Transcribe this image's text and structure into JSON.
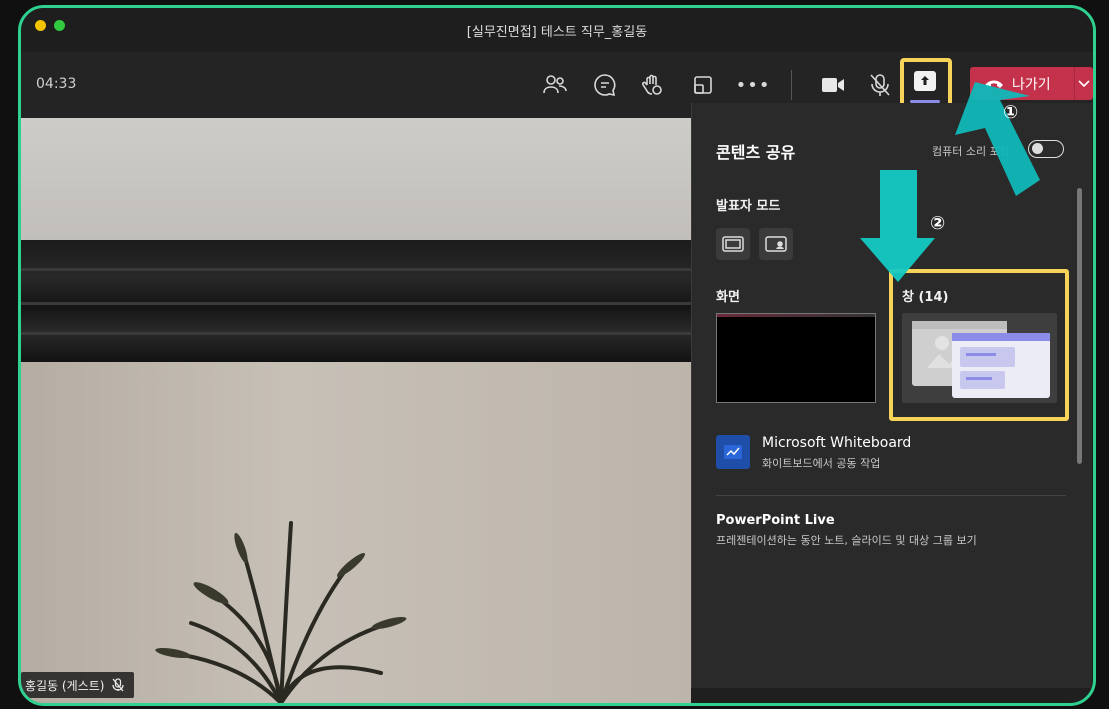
{
  "window": {
    "title": "[실무진면접] 테스트 직무_홍길동"
  },
  "toolbar": {
    "timer": "04:33",
    "leave_label": "나가기"
  },
  "video": {
    "participant_name": "홍길동 (게스트)"
  },
  "share_panel": {
    "title": "콘텐츠 공유",
    "include_sound_label": "컴퓨터 소리 포함",
    "presenter_mode_label": "발표자 모드",
    "screen_label": "화면",
    "window_label": "창 (14)",
    "whiteboard": {
      "title": "Microsoft Whiteboard",
      "subtitle": "화이트보드에서 공동 작업"
    },
    "powerpoint": {
      "title": "PowerPoint Live",
      "subtitle": "프레젠테이션하는 동안 노트, 슬라이드 및 대상 그룹 보기"
    }
  },
  "callouts": {
    "step1": "①",
    "step2": "②"
  },
  "colors": {
    "frame_border": "#2ed18f",
    "highlight": "#f7d35a",
    "arrow": "#14c9c3",
    "leave": "#c4314b"
  }
}
